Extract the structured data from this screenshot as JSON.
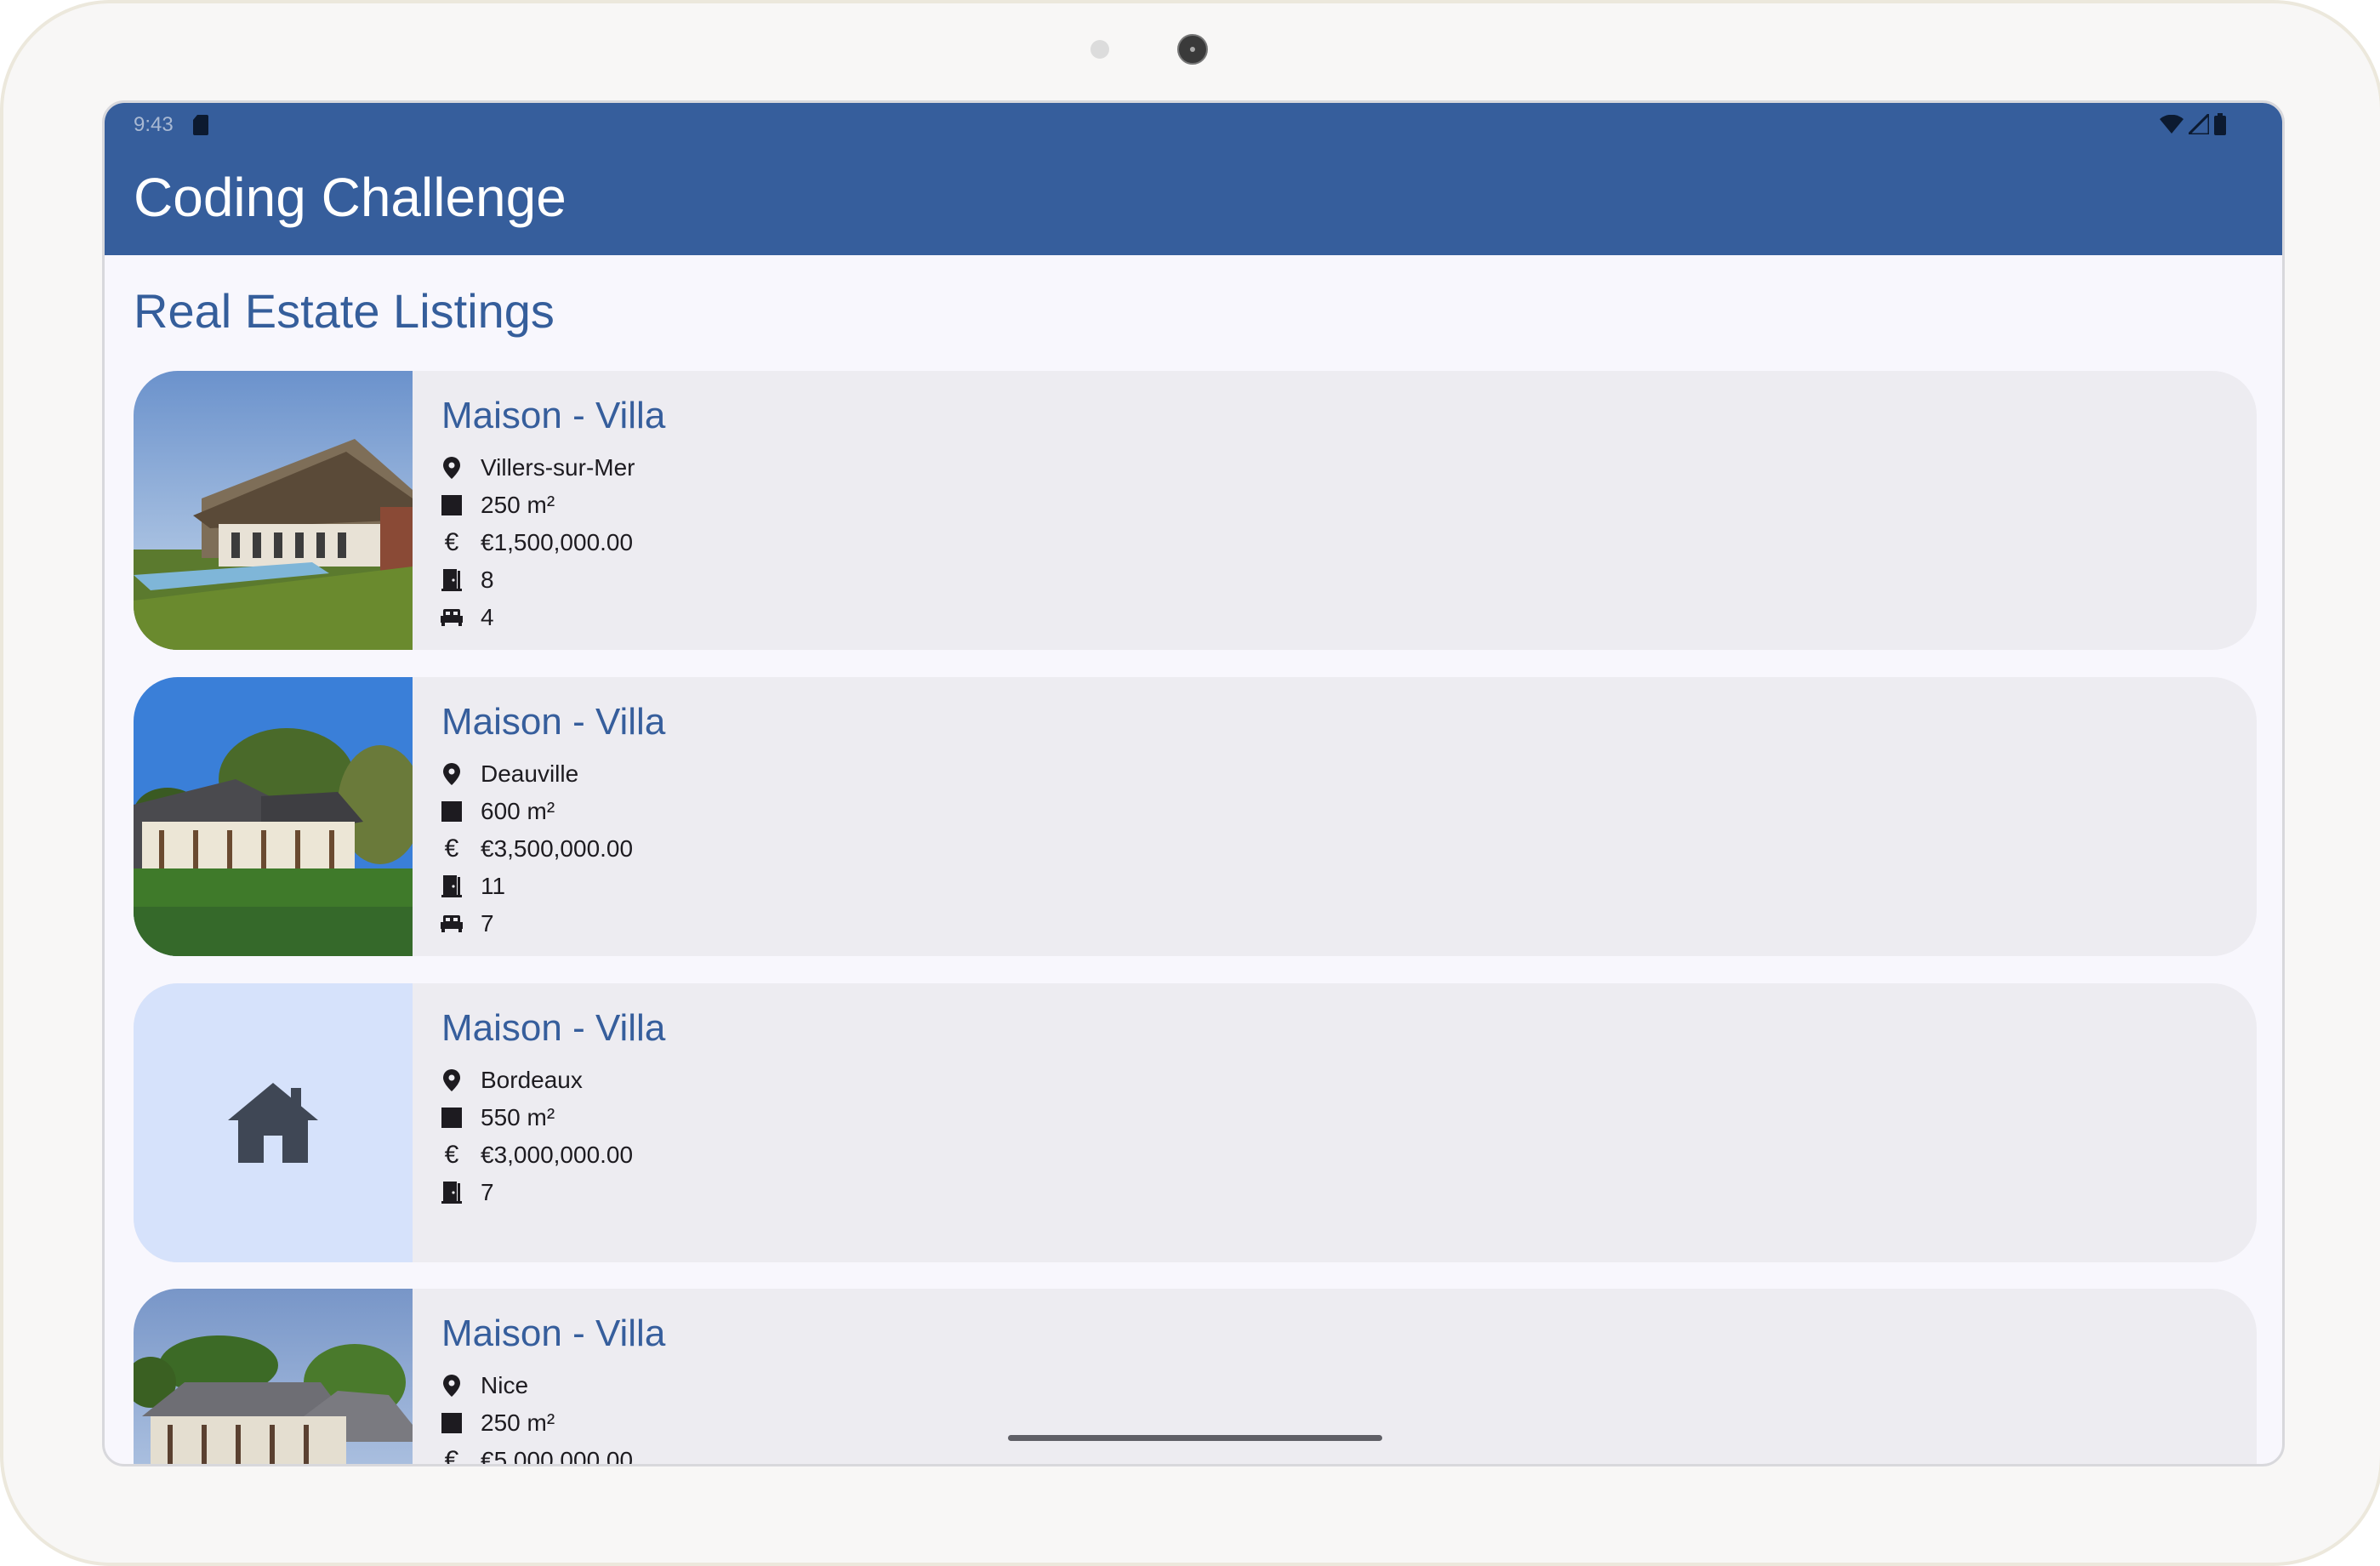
{
  "status_bar": {
    "time": "9:43"
  },
  "app_bar": {
    "title": "Coding Challenge"
  },
  "section_title": "Real Estate Listings",
  "listings": [
    {
      "title": "Maison - Villa",
      "city": "Villers-sur-Mer",
      "area": "250 m²",
      "price": "€1,500,000.00",
      "rooms": "8",
      "bedrooms": "4"
    },
    {
      "title": "Maison - Villa",
      "city": "Deauville",
      "area": "600 m²",
      "price": "€3,500,000.00",
      "rooms": "11",
      "bedrooms": "7"
    },
    {
      "title": "Maison - Villa",
      "city": "Bordeaux",
      "area": "550 m²",
      "price": "€3,000,000.00",
      "rooms": "7"
    },
    {
      "title": "Maison - Villa",
      "city": "Nice",
      "area": "250 m²",
      "price": "€5,000,000.00"
    }
  ],
  "icons": [
    "location-pin-icon",
    "area-square-icon",
    "euro-icon",
    "door-icon",
    "bed-icon",
    "house-icon"
  ],
  "colors": {
    "primary": "#365e9c",
    "card": "#edecf1",
    "background": "#f8f7fd",
    "placeholder": "#d6e2fb"
  }
}
